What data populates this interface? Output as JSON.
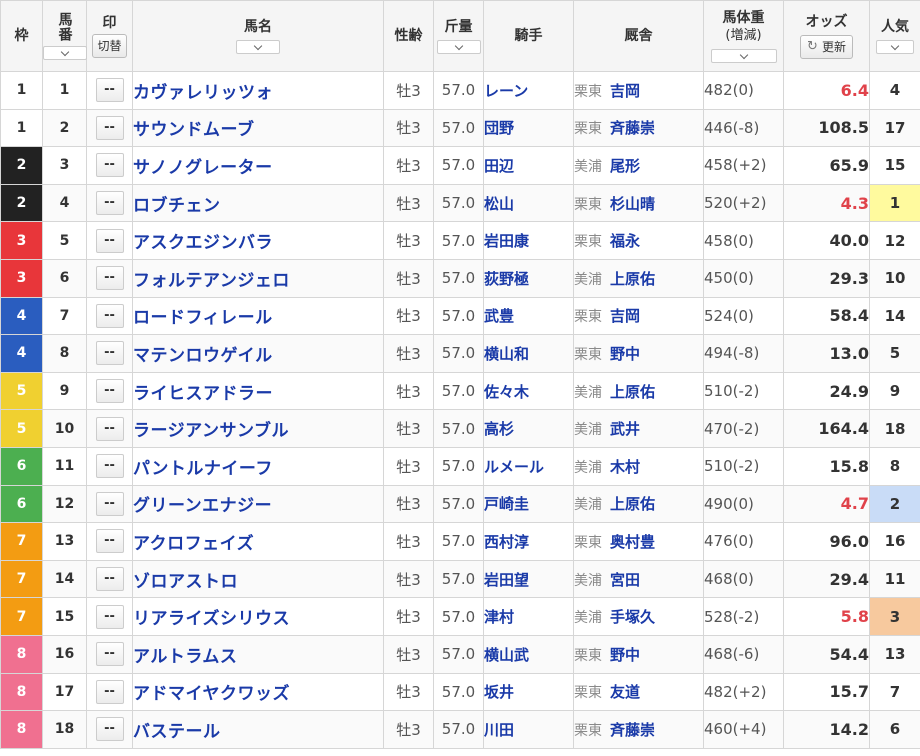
{
  "colors": {
    "waku": {
      "1": "#ffffff",
      "2": "#222222",
      "3": "#e8363a",
      "4": "#2a5dbf",
      "5": "#f0d030",
      "6": "#4caf50",
      "7": "#f39c12",
      "8": "#f07090"
    },
    "waku_text": {
      "1": "#333333",
      "2": "#ffffff",
      "3": "#ffffff",
      "4": "#ffffff",
      "5": "#ffffff",
      "6": "#ffffff",
      "7": "#ffffff",
      "8": "#ffffff"
    },
    "popular": {
      "1": "#fffa9e",
      "2": "#c9dcf7",
      "3": "#f7c99e"
    }
  },
  "header": {
    "waku": "枠",
    "umaban": "馬番",
    "mark": "印",
    "mark_toggle": "切替",
    "horse": "馬名",
    "sexage": "性齢",
    "kinryo": "斤量",
    "jockey": "騎手",
    "stable": "厩舎",
    "weight": "馬体重",
    "weight_sub": "(増減)",
    "odds": "オッズ",
    "refresh": "更新",
    "popular": "人気"
  },
  "mark_placeholder": "--",
  "rows": [
    {
      "waku": "1",
      "umaban": "1",
      "horse": "カヴァレリッツォ",
      "sexage": "牡3",
      "kinryo": "57.0",
      "jockey": "レーン",
      "region": "栗東",
      "trainer": "吉岡",
      "weight": "482(0)",
      "odds": "6.4",
      "fav": true,
      "pop": "4"
    },
    {
      "waku": "1",
      "umaban": "2",
      "horse": "サウンドムーブ",
      "sexage": "牡3",
      "kinryo": "57.0",
      "jockey": "団野",
      "region": "栗東",
      "trainer": "斉藤崇",
      "weight": "446(-8)",
      "odds": "108.5",
      "fav": false,
      "pop": "17"
    },
    {
      "waku": "2",
      "umaban": "3",
      "horse": "サノノグレーター",
      "sexage": "牡3",
      "kinryo": "57.0",
      "jockey": "田辺",
      "region": "美浦",
      "trainer": "尾形",
      "weight": "458(+2)",
      "odds": "65.9",
      "fav": false,
      "pop": "15"
    },
    {
      "waku": "2",
      "umaban": "4",
      "horse": "ロブチェン",
      "sexage": "牡3",
      "kinryo": "57.0",
      "jockey": "松山",
      "region": "栗東",
      "trainer": "杉山晴",
      "weight": "520(+2)",
      "odds": "4.3",
      "fav": true,
      "pop": "1"
    },
    {
      "waku": "3",
      "umaban": "5",
      "horse": "アスクエジンバラ",
      "sexage": "牡3",
      "kinryo": "57.0",
      "jockey": "岩田康",
      "region": "栗東",
      "trainer": "福永",
      "weight": "458(0)",
      "odds": "40.0",
      "fav": false,
      "pop": "12"
    },
    {
      "waku": "3",
      "umaban": "6",
      "horse": "フォルテアンジェロ",
      "sexage": "牡3",
      "kinryo": "57.0",
      "jockey": "荻野極",
      "region": "美浦",
      "trainer": "上原佑",
      "weight": "450(0)",
      "odds": "29.3",
      "fav": false,
      "pop": "10"
    },
    {
      "waku": "4",
      "umaban": "7",
      "horse": "ロードフィレール",
      "sexage": "牡3",
      "kinryo": "57.0",
      "jockey": "武豊",
      "region": "栗東",
      "trainer": "吉岡",
      "weight": "524(0)",
      "odds": "58.4",
      "fav": false,
      "pop": "14"
    },
    {
      "waku": "4",
      "umaban": "8",
      "horse": "マテンロウゲイル",
      "sexage": "牡3",
      "kinryo": "57.0",
      "jockey": "横山和",
      "region": "栗東",
      "trainer": "野中",
      "weight": "494(-8)",
      "odds": "13.0",
      "fav": false,
      "pop": "5"
    },
    {
      "waku": "5",
      "umaban": "9",
      "horse": "ライヒスアドラー",
      "sexage": "牡3",
      "kinryo": "57.0",
      "jockey": "佐々木",
      "region": "美浦",
      "trainer": "上原佑",
      "weight": "510(-2)",
      "odds": "24.9",
      "fav": false,
      "pop": "9"
    },
    {
      "waku": "5",
      "umaban": "10",
      "horse": "ラージアンサンブル",
      "sexage": "牡3",
      "kinryo": "57.0",
      "jockey": "高杉",
      "region": "美浦",
      "trainer": "武井",
      "weight": "470(-2)",
      "odds": "164.4",
      "fav": false,
      "pop": "18"
    },
    {
      "waku": "6",
      "umaban": "11",
      "horse": "パントルナイーフ",
      "sexage": "牡3",
      "kinryo": "57.0",
      "jockey": "ルメール",
      "region": "美浦",
      "trainer": "木村",
      "weight": "510(-2)",
      "odds": "15.8",
      "fav": false,
      "pop": "8"
    },
    {
      "waku": "6",
      "umaban": "12",
      "horse": "グリーンエナジー",
      "sexage": "牡3",
      "kinryo": "57.0",
      "jockey": "戸崎圭",
      "region": "美浦",
      "trainer": "上原佑",
      "weight": "490(0)",
      "odds": "4.7",
      "fav": true,
      "pop": "2"
    },
    {
      "waku": "7",
      "umaban": "13",
      "horse": "アクロフェイズ",
      "sexage": "牡3",
      "kinryo": "57.0",
      "jockey": "西村淳",
      "region": "栗東",
      "trainer": "奥村豊",
      "weight": "476(0)",
      "odds": "96.0",
      "fav": false,
      "pop": "16"
    },
    {
      "waku": "7",
      "umaban": "14",
      "horse": "ゾロアストロ",
      "sexage": "牡3",
      "kinryo": "57.0",
      "jockey": "岩田望",
      "region": "美浦",
      "trainer": "宮田",
      "weight": "468(0)",
      "odds": "29.4",
      "fav": false,
      "pop": "11"
    },
    {
      "waku": "7",
      "umaban": "15",
      "horse": "リアライズシリウス",
      "sexage": "牡3",
      "kinryo": "57.0",
      "jockey": "津村",
      "region": "美浦",
      "trainer": "手塚久",
      "weight": "528(-2)",
      "odds": "5.8",
      "fav": true,
      "pop": "3"
    },
    {
      "waku": "8",
      "umaban": "16",
      "horse": "アルトラムス",
      "sexage": "牡3",
      "kinryo": "57.0",
      "jockey": "横山武",
      "region": "栗東",
      "trainer": "野中",
      "weight": "468(-6)",
      "odds": "54.4",
      "fav": false,
      "pop": "13"
    },
    {
      "waku": "8",
      "umaban": "17",
      "horse": "アドマイヤクワッズ",
      "sexage": "牡3",
      "kinryo": "57.0",
      "jockey": "坂井",
      "region": "栗東",
      "trainer": "友道",
      "weight": "482(+2)",
      "odds": "15.7",
      "fav": false,
      "pop": "7"
    },
    {
      "waku": "8",
      "umaban": "18",
      "horse": "バステール",
      "sexage": "牡3",
      "kinryo": "57.0",
      "jockey": "川田",
      "region": "栗東",
      "trainer": "斉藤崇",
      "weight": "460(+4)",
      "odds": "14.2",
      "fav": false,
      "pop": "6"
    }
  ]
}
